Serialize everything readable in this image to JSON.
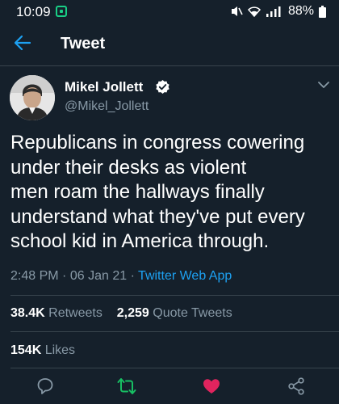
{
  "status_bar": {
    "time": "10:09",
    "battery_percent": "88%",
    "icons": [
      "app-notification-icon",
      "mute-icon",
      "wifi-icon",
      "signal-icon",
      "battery-icon"
    ]
  },
  "header": {
    "back_icon": "arrow-left-icon",
    "title": "Tweet"
  },
  "tweet": {
    "author": {
      "name": "Mikel Jollett",
      "handle": "@Mikel_Jollett",
      "verified": true
    },
    "text_lines": [
      "Republicans in congress cowering",
      "under their desks as violent",
      "men roam the hallways finally",
      "understand what they've put every",
      "school kid in America through."
    ],
    "time": "2:48 PM",
    "date": "06 Jan 21",
    "separator": "·",
    "source": "Twitter Web App"
  },
  "stats": {
    "retweets_count": "38.4K",
    "retweets_label": "Retweets",
    "quote_count": "2,259",
    "quote_label": "Quote Tweets",
    "likes_count": "154K",
    "likes_label": "Likes"
  },
  "actions": [
    {
      "name": "reply",
      "icon": "reply-icon",
      "color": "#8899a6"
    },
    {
      "name": "retweet",
      "icon": "retweet-icon",
      "color": "#17bf63",
      "active": true
    },
    {
      "name": "like",
      "icon": "heart-icon",
      "color": "#e0245e",
      "active": true
    },
    {
      "name": "share",
      "icon": "share-icon",
      "color": "#8899a6"
    }
  ],
  "colors": {
    "background": "#15202b",
    "divider": "#38444d",
    "secondary_text": "#8899a6",
    "accent": "#1da1f2",
    "retweet_active": "#17bf63",
    "like_active": "#e0245e"
  }
}
